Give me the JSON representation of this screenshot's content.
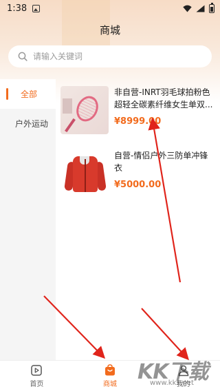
{
  "status_bar": {
    "time": "1:38"
  },
  "header": {
    "title": "商城"
  },
  "search": {
    "placeholder": "请输入关键词",
    "value": ""
  },
  "categories": [
    {
      "label": "全部",
      "active": true
    },
    {
      "label": "户外运动",
      "active": false
    }
  ],
  "products": [
    {
      "name": "非自营-INRT羽毛球拍粉色超轻全碳素纤维女生单双...",
      "price": "¥8999.00",
      "image": "pink-badminton-racket"
    },
    {
      "name": "自营-情侣户外三防单冲锋衣",
      "price": "¥5000.00",
      "image": "red-outdoor-jacket"
    }
  ],
  "bottom_nav": [
    {
      "label": "首页",
      "icon": "home-play-icon",
      "active": false
    },
    {
      "label": "商城",
      "icon": "shopping-bag-icon",
      "active": true
    },
    {
      "label": "我的",
      "icon": "user-icon",
      "active": false
    }
  ],
  "watermark": {
    "logo": "KK下载",
    "url": "www.kkx.net"
  },
  "colors": {
    "accent": "#f26b1d",
    "annotation_arrow": "#e0241b"
  }
}
